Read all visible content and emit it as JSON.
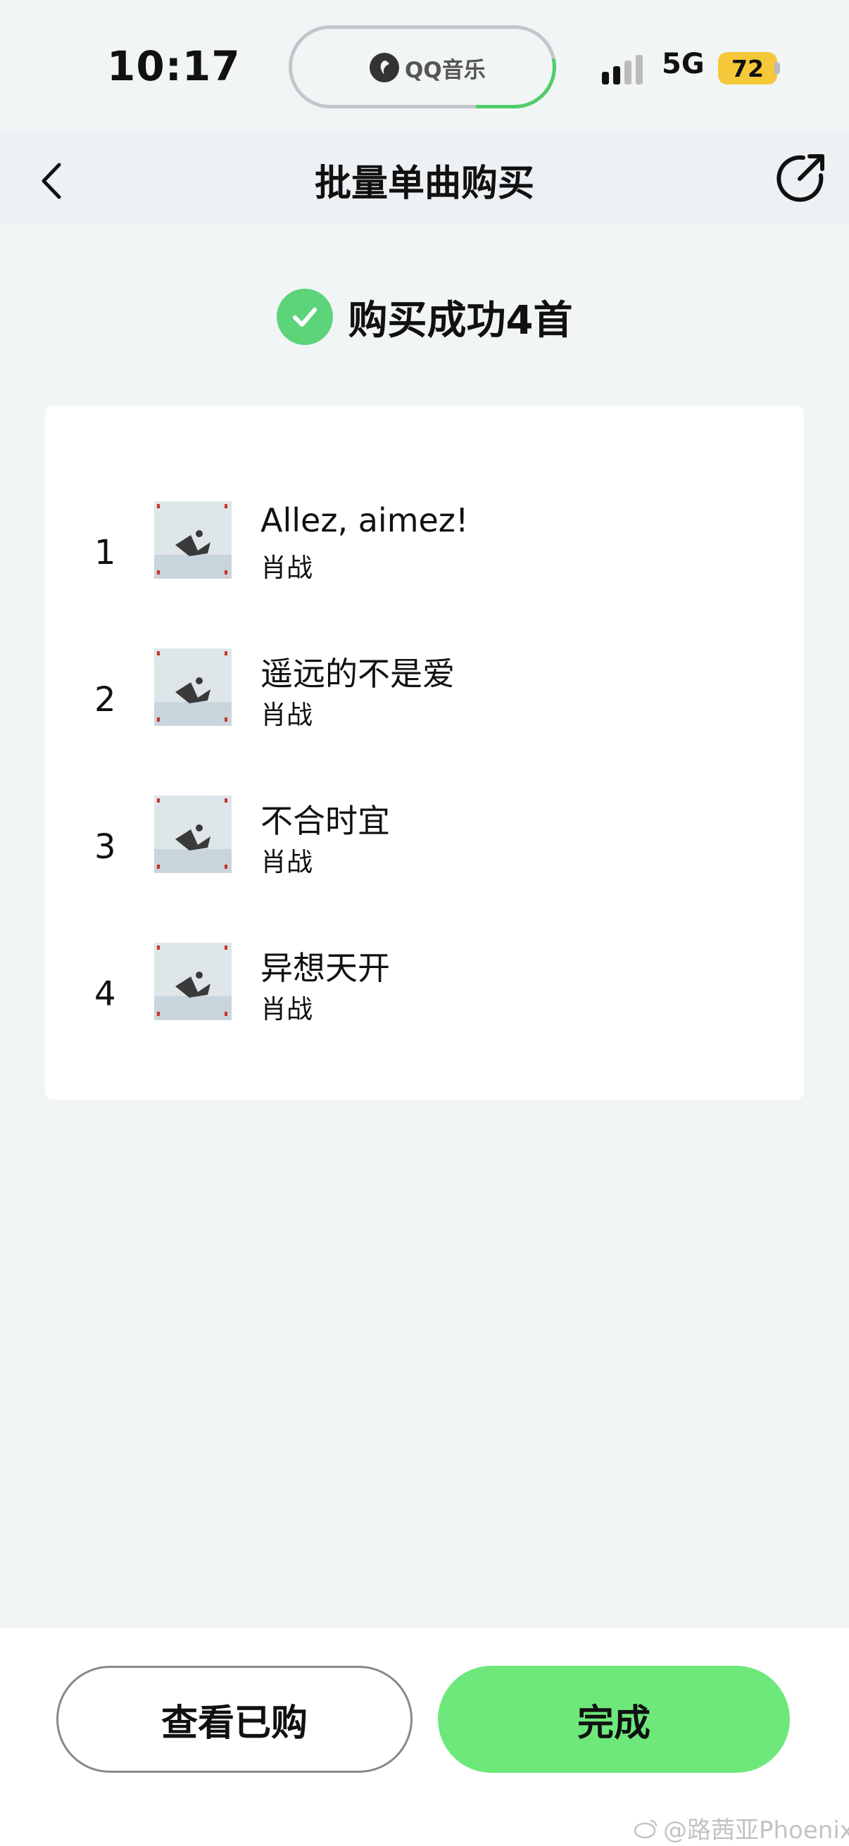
{
  "status_bar": {
    "time": "10:17",
    "live_activity_label": "QQ音乐",
    "network": "5G",
    "battery_level": "72"
  },
  "nav": {
    "title": "批量单曲购买"
  },
  "result": {
    "message": "购买成功4首"
  },
  "songs": [
    {
      "index": "1",
      "title": "Allez, aimez!",
      "artist": "肖战"
    },
    {
      "index": "2",
      "title": "遥远的不是爱",
      "artist": "肖战"
    },
    {
      "index": "3",
      "title": "不合时宜",
      "artist": "肖战"
    },
    {
      "index": "4",
      "title": "异想天开",
      "artist": "肖战"
    }
  ],
  "buttons": {
    "view_purchased": "查看已购",
    "done": "完成"
  },
  "watermark": "@路茜亚Phoenix",
  "colors": {
    "accent_green": "#6ee87b",
    "check_green": "#5dd37a",
    "battery_yellow": "#f5c83a",
    "background": "#f2f5f6"
  }
}
